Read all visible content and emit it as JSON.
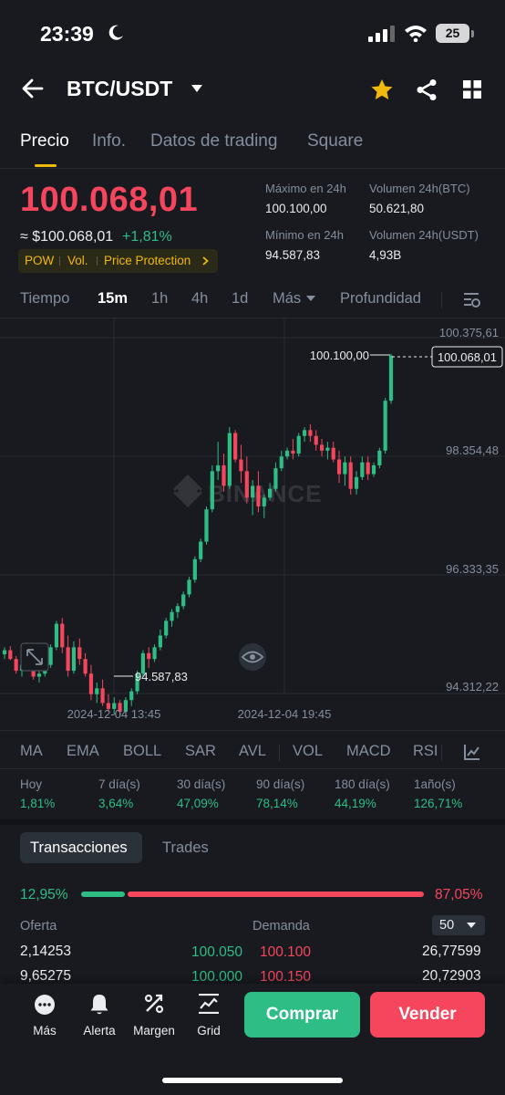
{
  "status": {
    "time": "23:39",
    "battery": "25"
  },
  "header": {
    "pair": "BTC/USDT"
  },
  "tabs": [
    "Precio",
    "Info.",
    "Datos de trading",
    "Square"
  ],
  "price": {
    "last": "100.068,01",
    "usd": "≈ $100.068,01",
    "change": "+1,81%",
    "badges": [
      "POW",
      "Vol.",
      "Price Protection"
    ]
  },
  "stats": {
    "high_label": "Máximo en 24h",
    "high": "100.100,00",
    "low_label": "Mínimo en 24h",
    "low": "94.587,83",
    "vol_btc_label": "Volumen 24h(BTC)",
    "vol_btc": "50.621,80",
    "vol_usdt_label": "Volumen 24h(USDT)",
    "vol_usdt": "4,93B"
  },
  "intervals": [
    "Tiempo",
    "15m",
    "1h",
    "4h",
    "1d",
    "Más",
    "Profundidad"
  ],
  "chart": {
    "y_labels": [
      "100.375,61",
      "98.354,48",
      "96.333,35",
      "94.312,22"
    ],
    "current_price": "100.068,01",
    "high_label": "100.100,00",
    "low_label": "94.587,83",
    "x_labels": [
      "2024-12-04 13:45",
      "2024-12-04 19:45"
    ],
    "watermark": "BINANCE",
    "colors": {
      "up": "#2ebd85",
      "down": "#f6465d"
    },
    "candles": [
      [
        94980,
        95100,
        94900,
        95050
      ],
      [
        95050,
        95120,
        94880,
        94900
      ],
      [
        94900,
        94950,
        94650,
        94700
      ],
      [
        94700,
        94850,
        94600,
        94800
      ],
      [
        94800,
        94900,
        94700,
        94850
      ],
      [
        94850,
        94950,
        94550,
        94600
      ],
      [
        94600,
        94700,
        94500,
        94650
      ],
      [
        94650,
        94850,
        94600,
        94800
      ],
      [
        94800,
        95150,
        94750,
        95100
      ],
      [
        95100,
        95550,
        95050,
        95500
      ],
      [
        95500,
        95600,
        95000,
        95100
      ],
      [
        95100,
        95300,
        94600,
        94700
      ],
      [
        94700,
        95200,
        94650,
        95100
      ],
      [
        95100,
        95250,
        94800,
        94900
      ],
      [
        94900,
        95000,
        94600,
        94650
      ],
      [
        94650,
        94800,
        94200,
        94300
      ],
      [
        94300,
        94500,
        94150,
        94400
      ],
      [
        94400,
        94550,
        94100,
        94150
      ],
      [
        94150,
        94300,
        94000,
        94050
      ],
      [
        94050,
        94250,
        93950,
        94150
      ],
      [
        94150,
        94200,
        93930,
        94000
      ],
      [
        94000,
        94250,
        93930,
        94200
      ],
      [
        94200,
        94400,
        94100,
        94350
      ],
      [
        94350,
        94700,
        94300,
        94650
      ],
      [
        94650,
        95050,
        94600,
        95000
      ],
      [
        95000,
        95100,
        94750,
        94900
      ],
      [
        94900,
        95150,
        94850,
        95100
      ],
      [
        95100,
        95400,
        95050,
        95300
      ],
      [
        95300,
        95600,
        95250,
        95550
      ],
      [
        95550,
        95750,
        95450,
        95700
      ],
      [
        95700,
        95850,
        95600,
        95800
      ],
      [
        95800,
        96050,
        95750,
        96000
      ],
      [
        96000,
        96300,
        95950,
        96250
      ],
      [
        96250,
        96650,
        96200,
        96600
      ],
      [
        96600,
        96950,
        96550,
        96900
      ],
      [
        96900,
        97500,
        96850,
        97450
      ],
      [
        97450,
        98200,
        97400,
        98100
      ],
      [
        98100,
        98600,
        97950,
        98200
      ],
      [
        98200,
        98400,
        97750,
        97850
      ],
      [
        97850,
        98850,
        97800,
        98750
      ],
      [
        98750,
        98800,
        98250,
        98300
      ],
      [
        98300,
        98550,
        97900,
        98100
      ],
      [
        98100,
        98350,
        97550,
        97650
      ],
      [
        97650,
        97950,
        97350,
        97850
      ],
      [
        97850,
        98100,
        97400,
        97500
      ],
      [
        97500,
        97700,
        97300,
        97650
      ],
      [
        97650,
        97900,
        97600,
        97800
      ],
      [
        97800,
        98250,
        97750,
        98150
      ],
      [
        98150,
        98450,
        98100,
        98350
      ],
      [
        98350,
        98500,
        98300,
        98450
      ],
      [
        98450,
        98650,
        98300,
        98400
      ],
      [
        98400,
        98750,
        98350,
        98700
      ],
      [
        98700,
        98850,
        98600,
        98800
      ],
      [
        98800,
        98900,
        98600,
        98700
      ],
      [
        98700,
        98800,
        98450,
        98550
      ],
      [
        98550,
        98650,
        98350,
        98450
      ],
      [
        98450,
        98600,
        98300,
        98500
      ],
      [
        98500,
        98600,
        98250,
        98300
      ],
      [
        98300,
        98450,
        97900,
        98050
      ],
      [
        98050,
        98350,
        97850,
        98250
      ],
      [
        98250,
        98350,
        97700,
        97800
      ],
      [
        97800,
        98100,
        97700,
        98000
      ],
      [
        98000,
        98350,
        97950,
        98250
      ],
      [
        98250,
        98350,
        97950,
        98050
      ],
      [
        98050,
        98250,
        98000,
        98200
      ],
      [
        98200,
        98500,
        98150,
        98450
      ],
      [
        98450,
        99350,
        98400,
        99300
      ],
      [
        99300,
        100100,
        99250,
        100068
      ]
    ]
  },
  "indicators": [
    "MA",
    "EMA",
    "BOLL",
    "SAR",
    "AVL",
    "VOL",
    "MACD",
    "RSI"
  ],
  "performance": [
    {
      "label": "Hoy",
      "value": "1,81%"
    },
    {
      "label": "7 día(s)",
      "value": "3,64%"
    },
    {
      "label": "30 día(s)",
      "value": "47,09%"
    },
    {
      "label": "90 día(s)",
      "value": "78,14%"
    },
    {
      "label": "180 día(s)",
      "value": "44,19%"
    },
    {
      "label": "1año(s)",
      "value": "126,71%"
    }
  ],
  "orderbook": {
    "tabs": [
      "Transacciones",
      "Trades"
    ],
    "bid_pct": "12,95%",
    "ask_pct": "87,05%",
    "bid_ratio": 0.1295,
    "bid_header": "Oferta",
    "ask_header": "Demanda",
    "depth": "50",
    "rows": [
      {
        "bid_qty": "2,14253",
        "bid_price": "100.050",
        "ask_price": "100.100",
        "ask_qty": "26,77599"
      },
      {
        "bid_qty": "9,65275",
        "bid_price": "100.000",
        "ask_price": "100.150",
        "ask_qty": "20,72903"
      }
    ]
  },
  "bottom": {
    "items": [
      "Más",
      "Alerta",
      "Margen",
      "Grid"
    ],
    "buy": "Comprar",
    "sell": "Vender"
  }
}
